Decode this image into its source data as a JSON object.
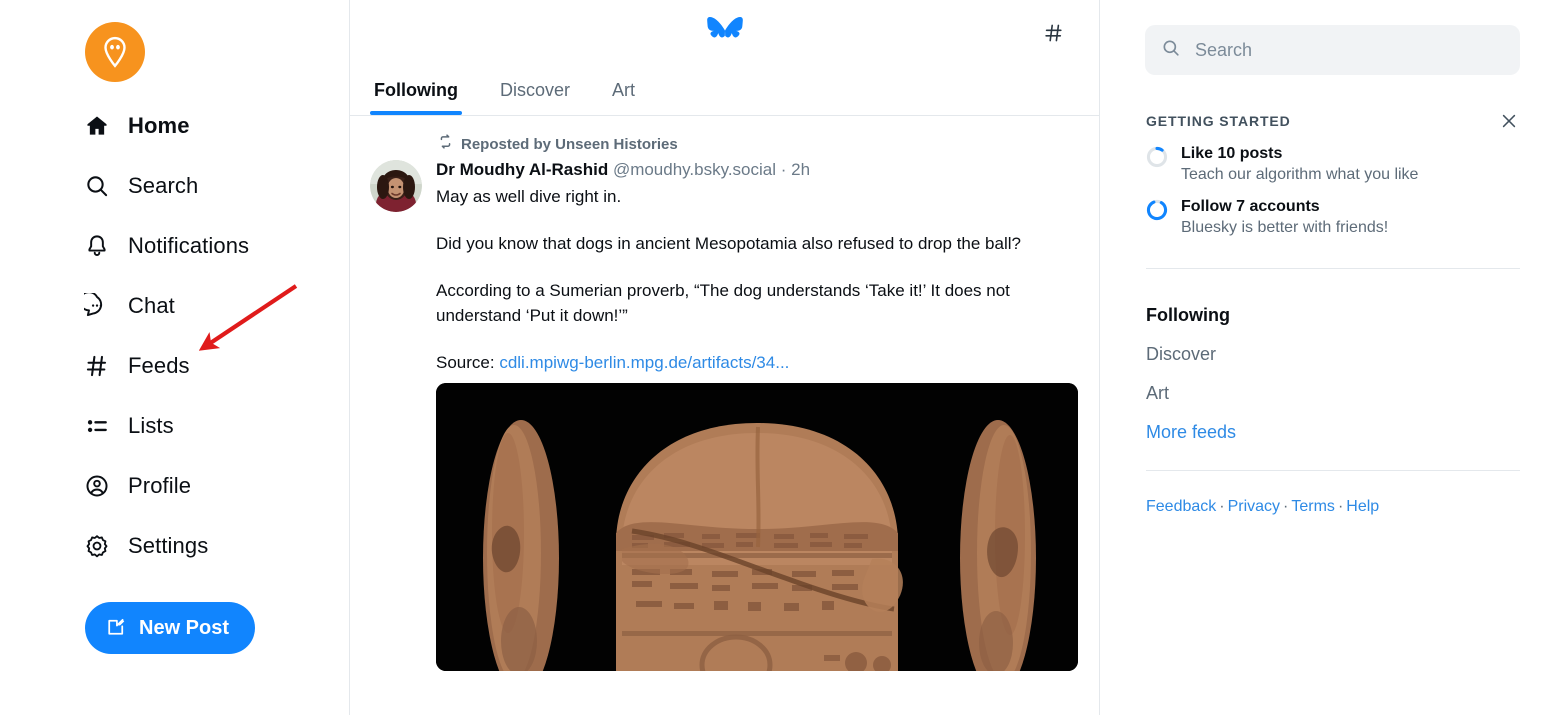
{
  "sidebar": {
    "avatar_icon": "alien-pin-avatar",
    "items": [
      {
        "label": "Home",
        "icon": "home-icon",
        "active": true
      },
      {
        "label": "Search",
        "icon": "search-icon",
        "active": false
      },
      {
        "label": "Notifications",
        "icon": "bell-icon",
        "active": false
      },
      {
        "label": "Chat",
        "icon": "chat-bubble-icon",
        "active": false
      },
      {
        "label": "Feeds",
        "icon": "hash-icon",
        "active": false
      },
      {
        "label": "Lists",
        "icon": "list-icon",
        "active": false
      },
      {
        "label": "Profile",
        "icon": "user-circle-icon",
        "active": false
      },
      {
        "label": "Settings",
        "icon": "gear-icon",
        "active": false
      }
    ],
    "new_post_label": "New Post",
    "new_post_icon": "compose-icon",
    "new_post_color": "#1185fe"
  },
  "feed_header": {
    "logo_icon": "bluesky-butterfly-logo",
    "logo_color": "#1185fe",
    "hash_icon": "hash-icon",
    "tabs": [
      {
        "label": "Following",
        "active": true
      },
      {
        "label": "Discover",
        "active": false
      },
      {
        "label": "Art",
        "active": false
      }
    ],
    "active_underline_color": "#1185fe"
  },
  "post": {
    "repost_icon": "repost-icon",
    "repost_label": "Reposted by Unseen Histories",
    "avatar_icon": "user-photo-avatar",
    "display_name": "Dr Moudhy Al-Rashid",
    "handle": "@moudhy.bsky.social",
    "separator": "·",
    "age": "2h",
    "lead_line": "May as well dive right in.",
    "paragraphs": [
      "Did you know that dogs in ancient Mesopotamia also refused to drop the ball?",
      "According to a Sumerian proverb, “The dog understands ‘Take it!’ It does not understand ‘Put it down!’”"
    ],
    "source_label": "Source:",
    "source_link": "cdli.mpiwg-berlin.mpg.de/artifacts/34...",
    "image_alt": "cuneiform-tablet-photo"
  },
  "search": {
    "icon": "search-icon",
    "placeholder": "Search",
    "value": ""
  },
  "getting_started": {
    "title": "GETTING STARTED",
    "close_icon": "close-icon",
    "items": [
      {
        "title": "Like 10 posts",
        "subtitle": "Teach our algorithm what you like",
        "progress": 10,
        "ring_icon": "progress-ring-icon"
      },
      {
        "title": "Follow 7 accounts",
        "subtitle": "Bluesky is better with friends!",
        "progress": 85,
        "ring_icon": "progress-ring-icon"
      }
    ],
    "ring_active_color": "#1185fe",
    "ring_track_color": "#dfe4e8"
  },
  "feeds_panel": {
    "items": [
      {
        "label": "Following",
        "current": true,
        "more": false
      },
      {
        "label": "Discover",
        "current": false,
        "more": false
      },
      {
        "label": "Art",
        "current": false,
        "more": false
      },
      {
        "label": "More feeds",
        "current": false,
        "more": true
      }
    ]
  },
  "footer": {
    "links": [
      "Feedback",
      "Privacy",
      "Terms",
      "Help"
    ],
    "separator": "·"
  },
  "annotation": {
    "arrow_color": "#e01b1b",
    "points_to": "Feeds"
  }
}
